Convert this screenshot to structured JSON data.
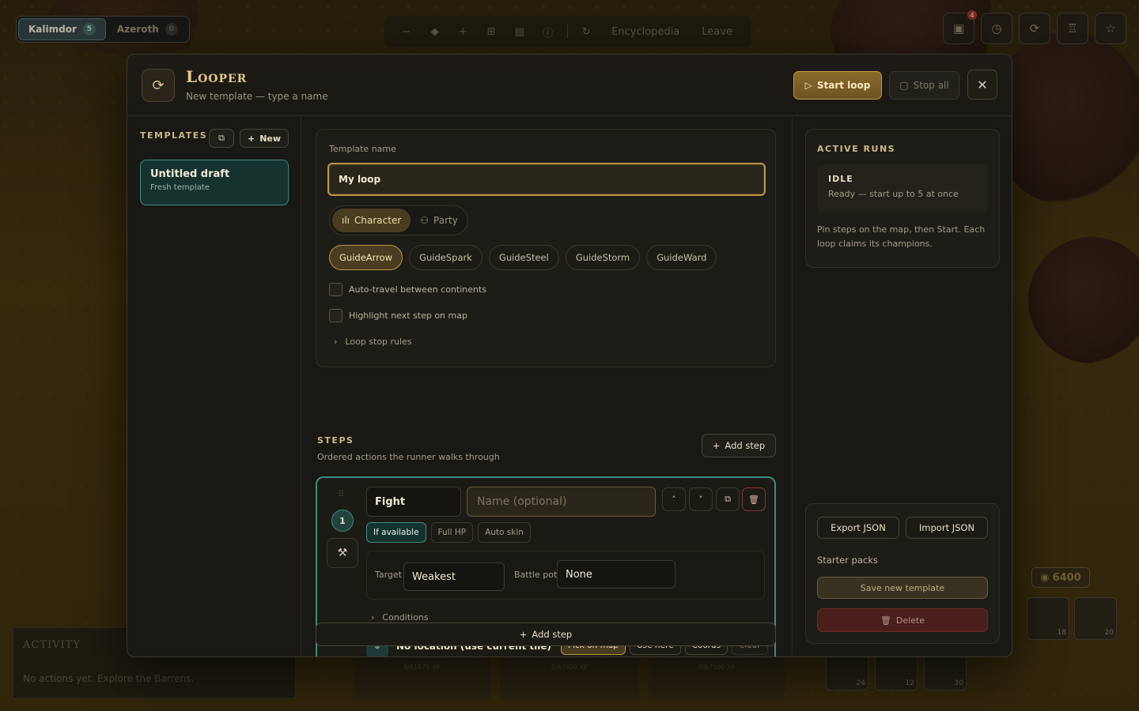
{
  "world_tabs": [
    {
      "label": "Kalimdor",
      "count": "5"
    },
    {
      "label": "Azeroth",
      "count": "0"
    }
  ],
  "toolbar": {
    "icons": [
      "−",
      "◆",
      "+",
      "⊞",
      "▤",
      "ⓘ",
      "↻"
    ],
    "encyclopedia": "Encyclopedia",
    "leave": "Leave"
  },
  "right_icons": {
    "notif_count": "4"
  },
  "activity": {
    "title": "ACTIVITY",
    "empty": "No actions yet. Explore the Barrens."
  },
  "gold": "6400",
  "inventory_counts": [
    "18",
    "20",
    "24",
    "12",
    "30"
  ],
  "bottom_cards": [
    "0/81875 XP",
    "0/67500 XP",
    "0/67500 XP"
  ],
  "modal": {
    "title": "Looper",
    "subtitle": "New template — type a name",
    "start_label": "Start loop",
    "stop_label": "Stop all"
  },
  "templates": {
    "heading": "TEMPLATES",
    "new_label": "New",
    "items": [
      {
        "name": "Untitled draft",
        "sub": "Fresh template"
      }
    ]
  },
  "editor": {
    "name_label": "Template name",
    "name_value": "My loop",
    "mode": {
      "character": "Character",
      "party": "Party"
    },
    "guides": [
      "GuideArrow",
      "GuideSpark",
      "GuideSteel",
      "GuideStorm",
      "GuideWard"
    ],
    "auto_travel": "Auto-travel between continents",
    "highlight": "Highlight next step on map",
    "stop_rules": "Loop stop rules"
  },
  "steps": {
    "heading": "STEPS",
    "sub": "Ordered actions the runner walks through",
    "add_label": "Add step",
    "step1": {
      "number": "1",
      "action": "Fight",
      "name_placeholder": "Name (optional)",
      "options": [
        "If available",
        "Full HP",
        "Auto skin"
      ],
      "target_label": "Target",
      "target_value": "Weakest",
      "pot_label": "Battle pot",
      "pot_value": "None",
      "conditions": "Conditions",
      "location": "No location (use current tile)",
      "loc_buttons": [
        "Pick on map",
        "Use here",
        "Coords",
        "Clear"
      ]
    }
  },
  "runs": {
    "heading": "ACTIVE RUNS",
    "status": "IDLE",
    "status_sub": "Ready — start up to 5 at once",
    "note": "Pin steps on the map, then Start. Each loop claims its champions."
  },
  "io": {
    "export": "Export JSON",
    "import": "Import JSON",
    "starter": "Starter packs",
    "save": "Save new template",
    "delete": "Delete"
  }
}
